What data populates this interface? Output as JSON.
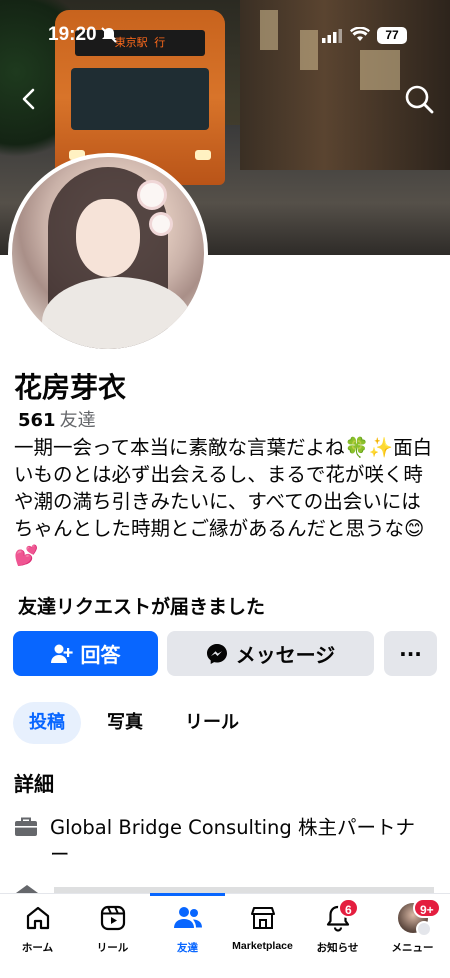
{
  "status_bar": {
    "time": "19:20",
    "battery": "77"
  },
  "cover": {
    "bus_display": "東京駅 行"
  },
  "profile": {
    "name": "花房芽衣",
    "friends_count": "561",
    "friends_label": "友達",
    "bio": "一期一会って本当に素敵な言葉だよね🍀✨面白いものとは必ず出会えるし、まるで花が咲く時や潮の満ち引きみたいに、すべての出会いにはちゃんとした時期とご縁があるんだと思うな😊💕"
  },
  "friend_request": {
    "text": "友達リクエストが届きました"
  },
  "actions": {
    "answer": "回答",
    "message": "メッセージ",
    "more": "···"
  },
  "tabs": [
    {
      "label": "投稿",
      "active": true
    },
    {
      "label": "写真",
      "active": false
    },
    {
      "label": "リール",
      "active": false
    }
  ],
  "details": {
    "heading": "詳細",
    "work": "Global Bridge Consulting 株主パートナー"
  },
  "bottom_nav": [
    {
      "label": "ホーム",
      "icon": "home-icon"
    },
    {
      "label": "リール",
      "icon": "reels-icon"
    },
    {
      "label": "友達",
      "icon": "friends-icon",
      "active": true
    },
    {
      "label": "Marketplace",
      "icon": "marketplace-icon"
    },
    {
      "label": "お知らせ",
      "icon": "bell-icon",
      "badge": "6"
    },
    {
      "label": "メニュー",
      "icon": "menu-avatar-icon",
      "badge": "9+"
    }
  ],
  "colors": {
    "accent": "#0866ff",
    "badge": "#e41e3f",
    "button_gray": "#e4e6eb"
  }
}
